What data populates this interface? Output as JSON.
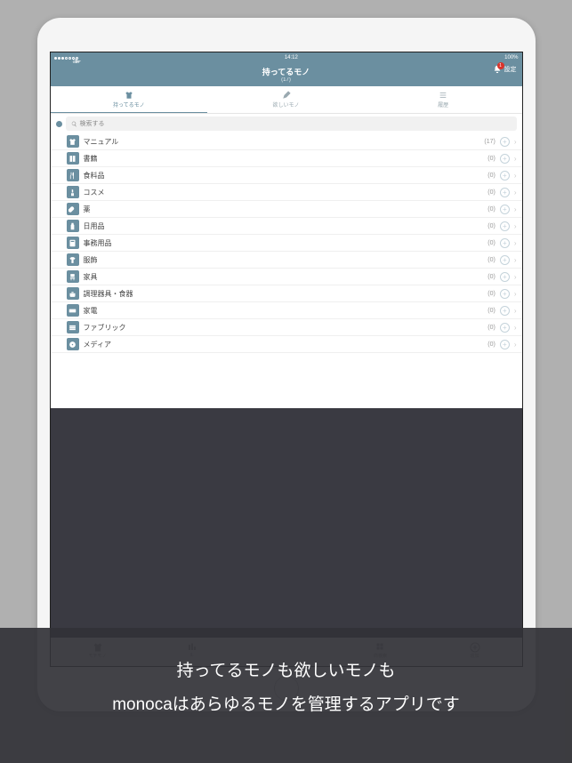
{
  "status": {
    "carrier": "通信事業者",
    "wifi": true,
    "time": "14:12",
    "battery": "100%"
  },
  "header": {
    "title": "持ってるモノ",
    "subtitle": "(17)",
    "settings_label": "設定",
    "badge_count": "1"
  },
  "tabs": [
    {
      "label": "持ってるモノ",
      "icon": "shirt-icon",
      "active": true
    },
    {
      "label": "欲しいモノ",
      "icon": "pencil-icon",
      "active": false
    },
    {
      "label": "履歴",
      "icon": "list-icon",
      "active": false
    }
  ],
  "search": {
    "placeholder": "検索する"
  },
  "categories": [
    {
      "icon": "shirt-icon",
      "label": "マニュアル",
      "count": "(17)"
    },
    {
      "icon": "book-icon",
      "label": "書籍",
      "count": "(0)"
    },
    {
      "icon": "utensils-icon",
      "label": "食料品",
      "count": "(0)"
    },
    {
      "icon": "lipstick-icon",
      "label": "コスメ",
      "count": "(0)"
    },
    {
      "icon": "pill-icon",
      "label": "薬",
      "count": "(0)"
    },
    {
      "icon": "bottle-icon",
      "label": "日用品",
      "count": "(0)"
    },
    {
      "icon": "calc-icon",
      "label": "事務用品",
      "count": "(0)"
    },
    {
      "icon": "tshirt-icon",
      "label": "服飾",
      "count": "(0)"
    },
    {
      "icon": "chair-icon",
      "label": "家具",
      "count": "(0)"
    },
    {
      "icon": "pot-icon",
      "label": "調理器具・食器",
      "count": "(0)"
    },
    {
      "icon": "keyboard-icon",
      "label": "家電",
      "count": "(0)"
    },
    {
      "icon": "fabric-icon",
      "label": "ファブリック",
      "count": "(0)"
    },
    {
      "icon": "disc-icon",
      "label": "メディア",
      "count": "(0)"
    }
  ],
  "bottom_tabs": [
    {
      "label": "モチモノ",
      "icon": "shirt-icon"
    },
    {
      "label": "IL",
      "icon": "bars-icon"
    },
    {
      "label": "",
      "icon": "blank-icon"
    },
    {
      "label": "商検索",
      "icon": "grid-icon"
    },
    {
      "label": "追加",
      "icon": "plus-circle-icon"
    }
  ],
  "promo": {
    "line1": "持ってるモノも欲しいモノも",
    "line2": "monocaはあらゆるモノを管理するアプリです"
  },
  "colors": {
    "accent": "#6b8fa0",
    "badge": "#d9342b"
  }
}
